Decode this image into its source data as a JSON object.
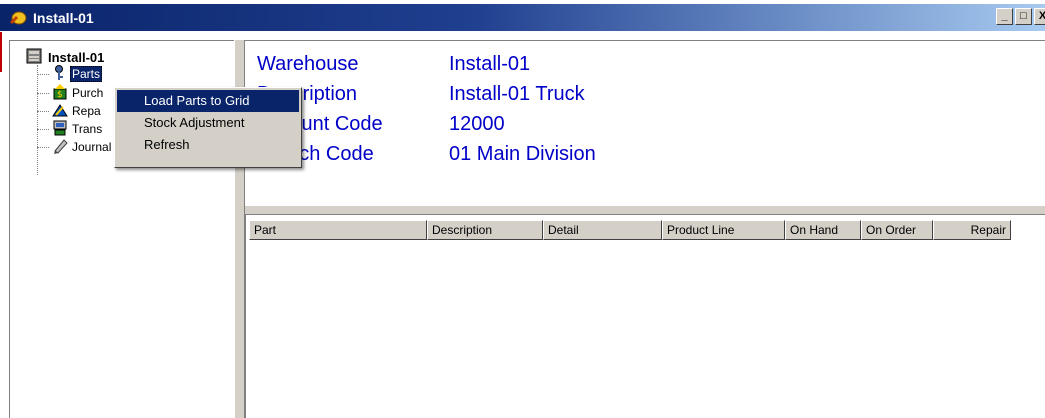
{
  "window": {
    "title": "Install-01",
    "buttons": {
      "minimize": "_",
      "maximize": "□",
      "close": "X"
    }
  },
  "tree": {
    "root": {
      "label": "Install-01",
      "icon": "database-icon"
    },
    "items": [
      {
        "label": "Parts",
        "icon": "key-icon",
        "selected": true
      },
      {
        "label": "Purch",
        "icon": "purchase-icon"
      },
      {
        "label": "Repa",
        "icon": "repair-icon"
      },
      {
        "label": "Trans",
        "icon": "transfer-icon"
      },
      {
        "label": "Journal",
        "icon": "journal-icon"
      }
    ]
  },
  "context_menu": {
    "items": [
      {
        "label": "Load Parts to Grid",
        "highlighted": true
      },
      {
        "label": "Stock Adjustment"
      },
      {
        "label": "Refresh"
      }
    ]
  },
  "info": {
    "rows": [
      {
        "label": "Warehouse",
        "value": "Install-01"
      },
      {
        "label": "Description",
        "value": "Install-01 Truck"
      },
      {
        "label": "Account Code",
        "value": "12000"
      },
      {
        "label": "Branch Code",
        "value": "01 Main Division"
      }
    ],
    "text_color": "#0000c8"
  },
  "grid": {
    "columns": [
      "Part",
      "Description",
      "Detail",
      "Product Line",
      "On Hand",
      "On Order",
      "Repair"
    ],
    "rows": []
  },
  "colors": {
    "title_start": "#0a246a",
    "title_end": "#a6caf0",
    "face": "#d4d0c8",
    "selection": "#0a246a"
  }
}
